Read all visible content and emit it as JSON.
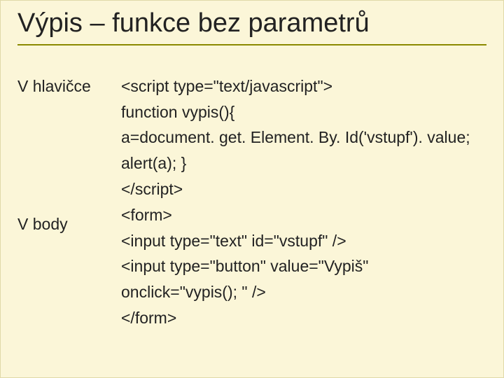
{
  "title": "Výpis – funkce bez parametrů",
  "labels": {
    "head": "V hlavičce",
    "body": "V body"
  },
  "code": {
    "l1": "<script type=\"text/javascript\">",
    "l2": "function vypis(){",
    "l3": "a=document. get. Element. By. Id('vstupf'). value;",
    "l4": "alert(a); }",
    "l5": "</scr",
    "l5b": "ipt>",
    "l6": "<form>",
    "l7": "<input type=\"text\" id=\"vstupf\" />",
    "l8": "<input type=\"button\" value=\"Vypiš\"",
    "l9": "onclick=\"vypis(); \" />",
    "l10": "</form>"
  }
}
